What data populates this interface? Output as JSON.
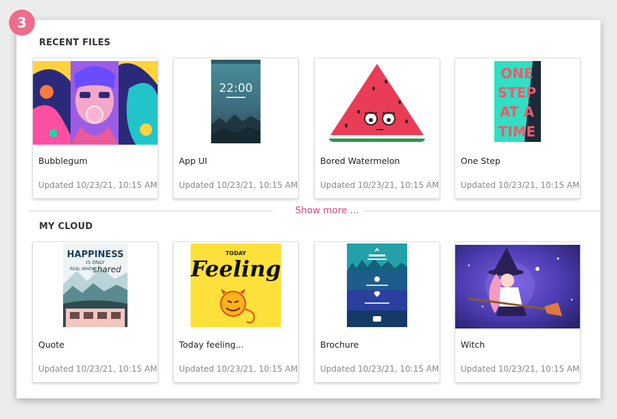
{
  "step_badge": "3",
  "recent": {
    "title": "RECENT FILES",
    "files": [
      {
        "name": "Bubblegum",
        "updated": "Updated 10/23/21, 10:15 AM"
      },
      {
        "name": "App  UI",
        "updated": "Updated 10/23/21, 10:15 AM",
        "thumb_text": "22:00"
      },
      {
        "name": "Bored Watermelon",
        "updated": "Updated 10/23/21, 10:15 AM"
      },
      {
        "name": "One Step",
        "updated": "Updated 10/23/21, 10:15 AM",
        "thumb_lines": [
          "ONE",
          "STEP",
          "AT A",
          "TIME"
        ]
      }
    ]
  },
  "show_more_label": "Show more ...",
  "cloud": {
    "title": "MY CLOUD",
    "files": [
      {
        "name": "Quote",
        "updated": "Updated 10/23/21, 10:15 AM",
        "thumb_lines": [
          "HAPPINESS",
          "IS ONLY",
          "REAL WHEN",
          "shared"
        ]
      },
      {
        "name": "Today feeling...",
        "updated": "Updated 10/23/21, 10:15 AM",
        "thumb_lines": [
          "TODAY",
          "Feeling"
        ]
      },
      {
        "name": "Brochure",
        "updated": "Updated 10/23/21, 10:15 AM"
      },
      {
        "name": "Witch",
        "updated": "Updated 10/23/21, 10:15 AM"
      }
    ]
  },
  "colors": {
    "accent": "#d23f76",
    "badge": "#ef6c8c"
  }
}
